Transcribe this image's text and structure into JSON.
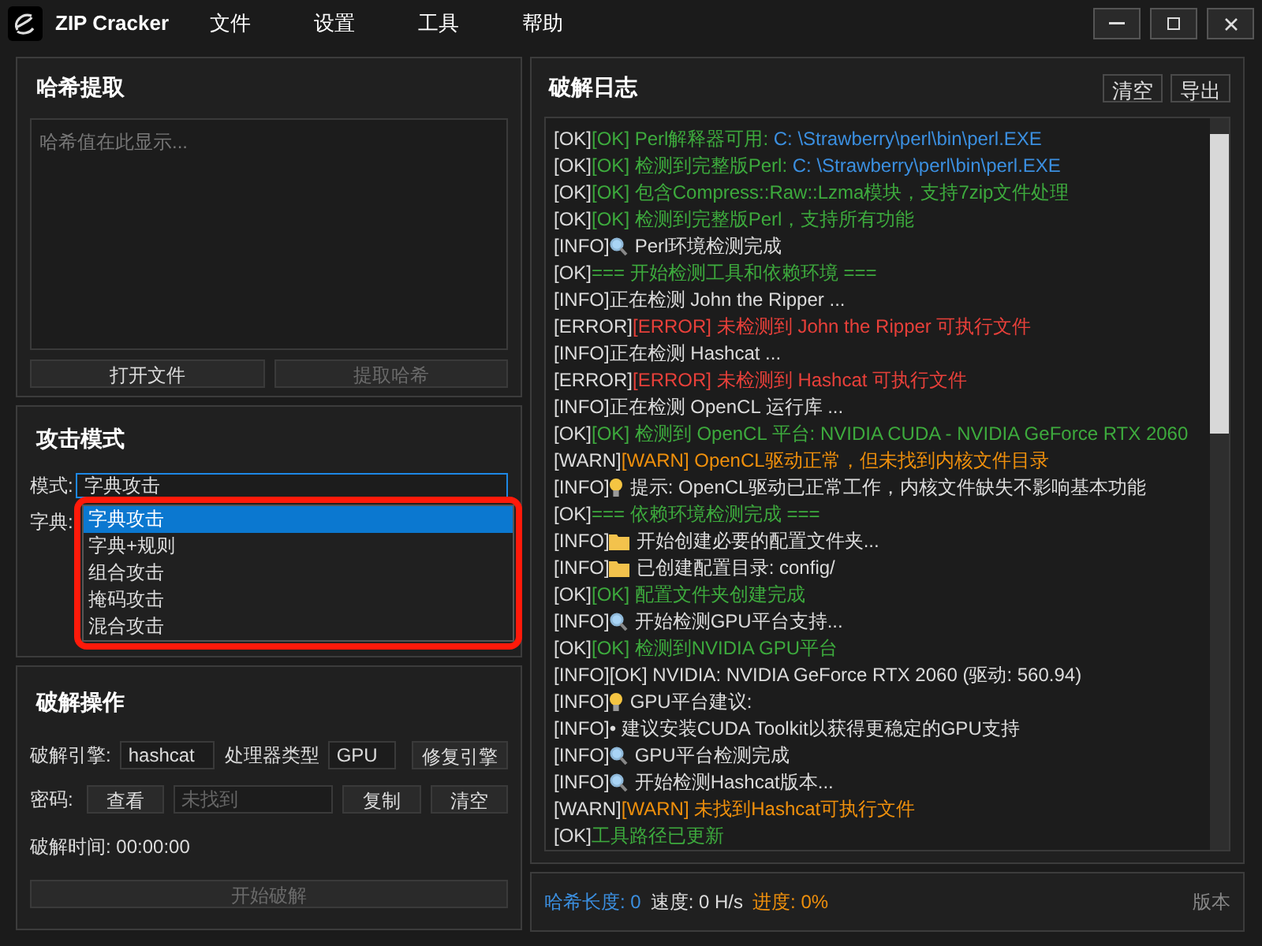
{
  "window": {
    "title": "ZIP Cracker",
    "menu": [
      "文件",
      "设置",
      "工具",
      "帮助"
    ]
  },
  "hash_panel": {
    "title": "哈希提取",
    "placeholder": "哈希值在此显示...",
    "buttons": [
      {
        "label": "打开文件",
        "disabled": false
      },
      {
        "label": "提取哈希",
        "disabled": true
      }
    ]
  },
  "attack_panel": {
    "title": "攻击模式",
    "mode_label": "模式:",
    "mode_value": "字典攻击",
    "dict_label": "字典:",
    "dropdown": {
      "highlighted": true,
      "options": [
        {
          "label": "字典攻击",
          "selected": true
        },
        {
          "label": "字典+规则",
          "selected": false
        },
        {
          "label": "组合攻击",
          "selected": false
        },
        {
          "label": "掩码攻击",
          "selected": false
        },
        {
          "label": "混合攻击",
          "selected": false
        }
      ]
    }
  },
  "crack_panel": {
    "title": "破解操作",
    "engine_label": "破解引擎:",
    "engine_value": "hashcat",
    "processor_label": "处理器类型",
    "processor_value": "GPU",
    "repair_button": "修复引擎",
    "password_label": "密码:",
    "view_button": "查看",
    "password_placeholder": "未找到",
    "copy_button": "复制",
    "clear_button": "清空",
    "time_label": "破解时间: 00:00:00",
    "start_button": {
      "label": "开始破解",
      "disabled": true
    }
  },
  "log_panel": {
    "title": "破解日志",
    "buttons": [
      "清空",
      "导出"
    ],
    "lines": [
      {
        "prefix": "[OK]",
        "parts": [
          {
            "text": "[OK] Perl解释器可用: ",
            "kind": "ok"
          },
          {
            "text": "C: \\Strawberry\\perl\\bin\\perl.EXE",
            "kind": "path"
          }
        ]
      },
      {
        "prefix": "[OK]",
        "parts": [
          {
            "text": "[OK] 检测到完整版Perl: ",
            "kind": "ok"
          },
          {
            "text": "C: \\Strawberry\\perl\\bin\\perl.EXE",
            "kind": "path"
          }
        ]
      },
      {
        "prefix": "[OK]",
        "parts": [
          {
            "text": "[OK] 包含Compress::Raw::Lzma模块，支持7zip文件处理",
            "kind": "ok"
          }
        ]
      },
      {
        "prefix": "[OK]",
        "parts": [
          {
            "text": "[OK] 检测到完整版Perl，支持所有功能",
            "kind": "ok"
          }
        ]
      },
      {
        "prefix": "[INFO]",
        "kind": "search",
        "parts": [
          {
            "text": "Perl环境检测完成",
            "kind": "info"
          }
        ]
      },
      {
        "prefix": "[OK]",
        "parts": [
          {
            "text": "=== 开始检测工具和依赖环境 ===",
            "kind": "ok"
          }
        ]
      },
      {
        "prefix": "[INFO]",
        "parts": [
          {
            "text": "正在检测 John the Ripper ...",
            "kind": "info"
          }
        ]
      },
      {
        "prefix": "[ERROR]",
        "parts": [
          {
            "text": "[ERROR] 未检测到 John the Ripper 可执行文件",
            "kind": "error"
          }
        ]
      },
      {
        "prefix": "[INFO]",
        "parts": [
          {
            "text": "正在检测 Hashcat ...",
            "kind": "info"
          }
        ]
      },
      {
        "prefix": "[ERROR]",
        "parts": [
          {
            "text": "[ERROR] 未检测到 Hashcat 可执行文件",
            "kind": "error"
          }
        ]
      },
      {
        "prefix": "[INFO]",
        "parts": [
          {
            "text": "正在检测 OpenCL 运行库 ...",
            "kind": "info"
          }
        ]
      },
      {
        "prefix": "[OK]",
        "parts": [
          {
            "text": "[OK] 检测到 OpenCL 平台: NVIDIA CUDA - NVIDIA GeForce RTX 2060",
            "kind": "ok"
          }
        ]
      },
      {
        "prefix": "[WARN]",
        "parts": [
          {
            "text": "[WARN] OpenCL驱动正常，但未找到内核文件目录",
            "kind": "warn"
          }
        ]
      },
      {
        "prefix": "[INFO]",
        "kind": "bulb",
        "parts": [
          {
            "text": "提示: OpenCL驱动已正常工作，内核文件缺失不影响基本功能",
            "kind": "info"
          }
        ]
      },
      {
        "prefix": "[OK]",
        "parts": [
          {
            "text": "=== 依赖环境检测完成 ===",
            "kind": "ok"
          }
        ]
      },
      {
        "prefix": "[INFO]",
        "kind": "folder",
        "parts": [
          {
            "text": "开始创建必要的配置文件夹...",
            "kind": "info"
          }
        ]
      },
      {
        "prefix": "[INFO]",
        "kind": "folder",
        "parts": [
          {
            "text": "已创建配置目录: config/",
            "kind": "info"
          }
        ]
      },
      {
        "prefix": "[OK]",
        "parts": [
          {
            "text": "[OK] 配置文件夹创建完成",
            "kind": "ok"
          }
        ]
      },
      {
        "prefix": "[INFO]",
        "kind": "search",
        "parts": [
          {
            "text": "开始检测GPU平台支持...",
            "kind": "info"
          }
        ]
      },
      {
        "prefix": "[OK]",
        "parts": [
          {
            "text": "[OK] 检测到NVIDIA GPU平台",
            "kind": "ok"
          }
        ]
      },
      {
        "prefix": "[INFO]",
        "parts": [
          {
            "text": "[OK] NVIDIA: NVIDIA GeForce RTX 2060 (驱动: 560.94)",
            "kind": "info"
          }
        ]
      },
      {
        "prefix": "[INFO]",
        "kind": "bulb",
        "parts": [
          {
            "text": "GPU平台建议:",
            "kind": "info"
          }
        ]
      },
      {
        "prefix": "[INFO]",
        "parts": [
          {
            "text": "• 建议安装CUDA Toolkit以获得更稳定的GPU支持",
            "kind": "info"
          }
        ]
      },
      {
        "prefix": "[INFO]",
        "kind": "search",
        "parts": [
          {
            "text": "GPU平台检测完成",
            "kind": "info"
          }
        ]
      },
      {
        "prefix": "[INFO]",
        "kind": "search",
        "parts": [
          {
            "text": "开始检测Hashcat版本...",
            "kind": "info"
          }
        ]
      },
      {
        "prefix": "[WARN]",
        "parts": [
          {
            "text": "[WARN] 未找到Hashcat可执行文件",
            "kind": "warn"
          }
        ]
      },
      {
        "prefix": "[OK]",
        "parts": [
          {
            "text": "工具路径已更新",
            "kind": "ok"
          }
        ]
      }
    ]
  },
  "status_bar": [
    {
      "text": "哈希长度: 0",
      "kind": "path"
    },
    {
      "text": "速度: 0 H/s",
      "kind": "info"
    },
    {
      "text": "进度: 0%",
      "kind": "warn"
    }
  ],
  "version": "版本"
}
